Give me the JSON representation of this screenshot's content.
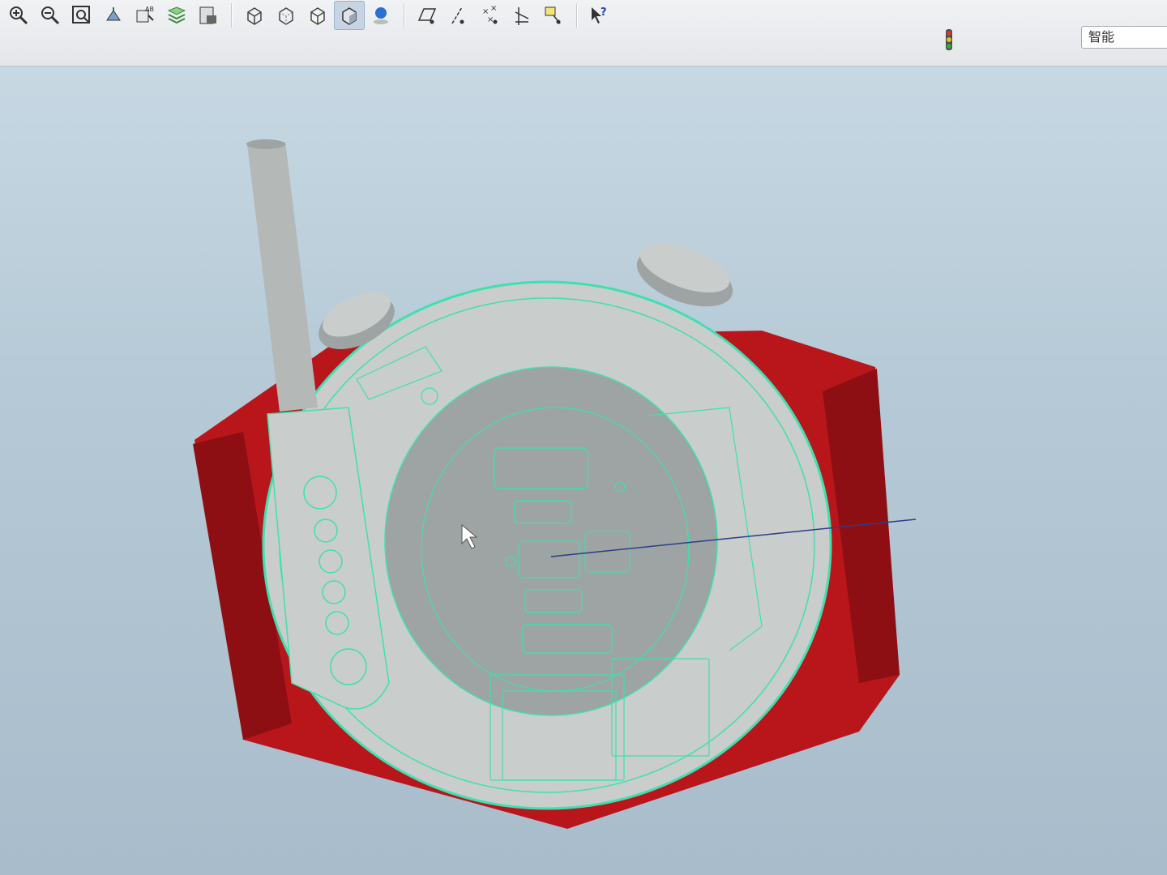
{
  "toolbar": {
    "buttons": [
      {
        "id": "zoom-in",
        "icon": "zoom-in-icon"
      },
      {
        "id": "zoom-out",
        "icon": "zoom-out-icon"
      },
      {
        "id": "refit",
        "icon": "refit-icon"
      },
      {
        "id": "reorient",
        "icon": "reorient-icon"
      },
      {
        "id": "saved-views",
        "icon": "named-view-icon"
      },
      {
        "id": "layers",
        "icon": "layers-icon"
      },
      {
        "id": "view-manager",
        "icon": "view-manager-icon"
      },
      {
        "id": "wireframe",
        "icon": "wireframe-icon"
      },
      {
        "id": "hidden-line",
        "icon": "hidden-line-icon"
      },
      {
        "id": "no-hidden",
        "icon": "no-hidden-icon"
      },
      {
        "id": "shading",
        "icon": "shading-icon",
        "active": true
      },
      {
        "id": "appearance",
        "icon": "appearance-sphere-icon"
      },
      {
        "id": "datum-planes",
        "icon": "datum-plane-icon"
      },
      {
        "id": "datum-axes",
        "icon": "datum-axis-icon"
      },
      {
        "id": "datum-points",
        "icon": "datum-point-icon"
      },
      {
        "id": "csys",
        "icon": "coordinate-system-icon"
      },
      {
        "id": "annotations",
        "icon": "annotation-icon"
      },
      {
        "id": "context-help",
        "icon": "context-help-icon"
      }
    ],
    "ab_label": "AB",
    "filter_value": "智能",
    "status_colors": {
      "red": "#d43a2a",
      "yellow": "#e0c020",
      "green": "#2bb02b"
    }
  },
  "viewport": {
    "colors": {
      "band": "#b8161b",
      "band_dark": "#8e0f13",
      "case": "#c9cdcb",
      "case_dark": "#9ea4a3",
      "edge_highlight": "#3fe0b0",
      "cyl": "#b4b8b7"
    }
  }
}
